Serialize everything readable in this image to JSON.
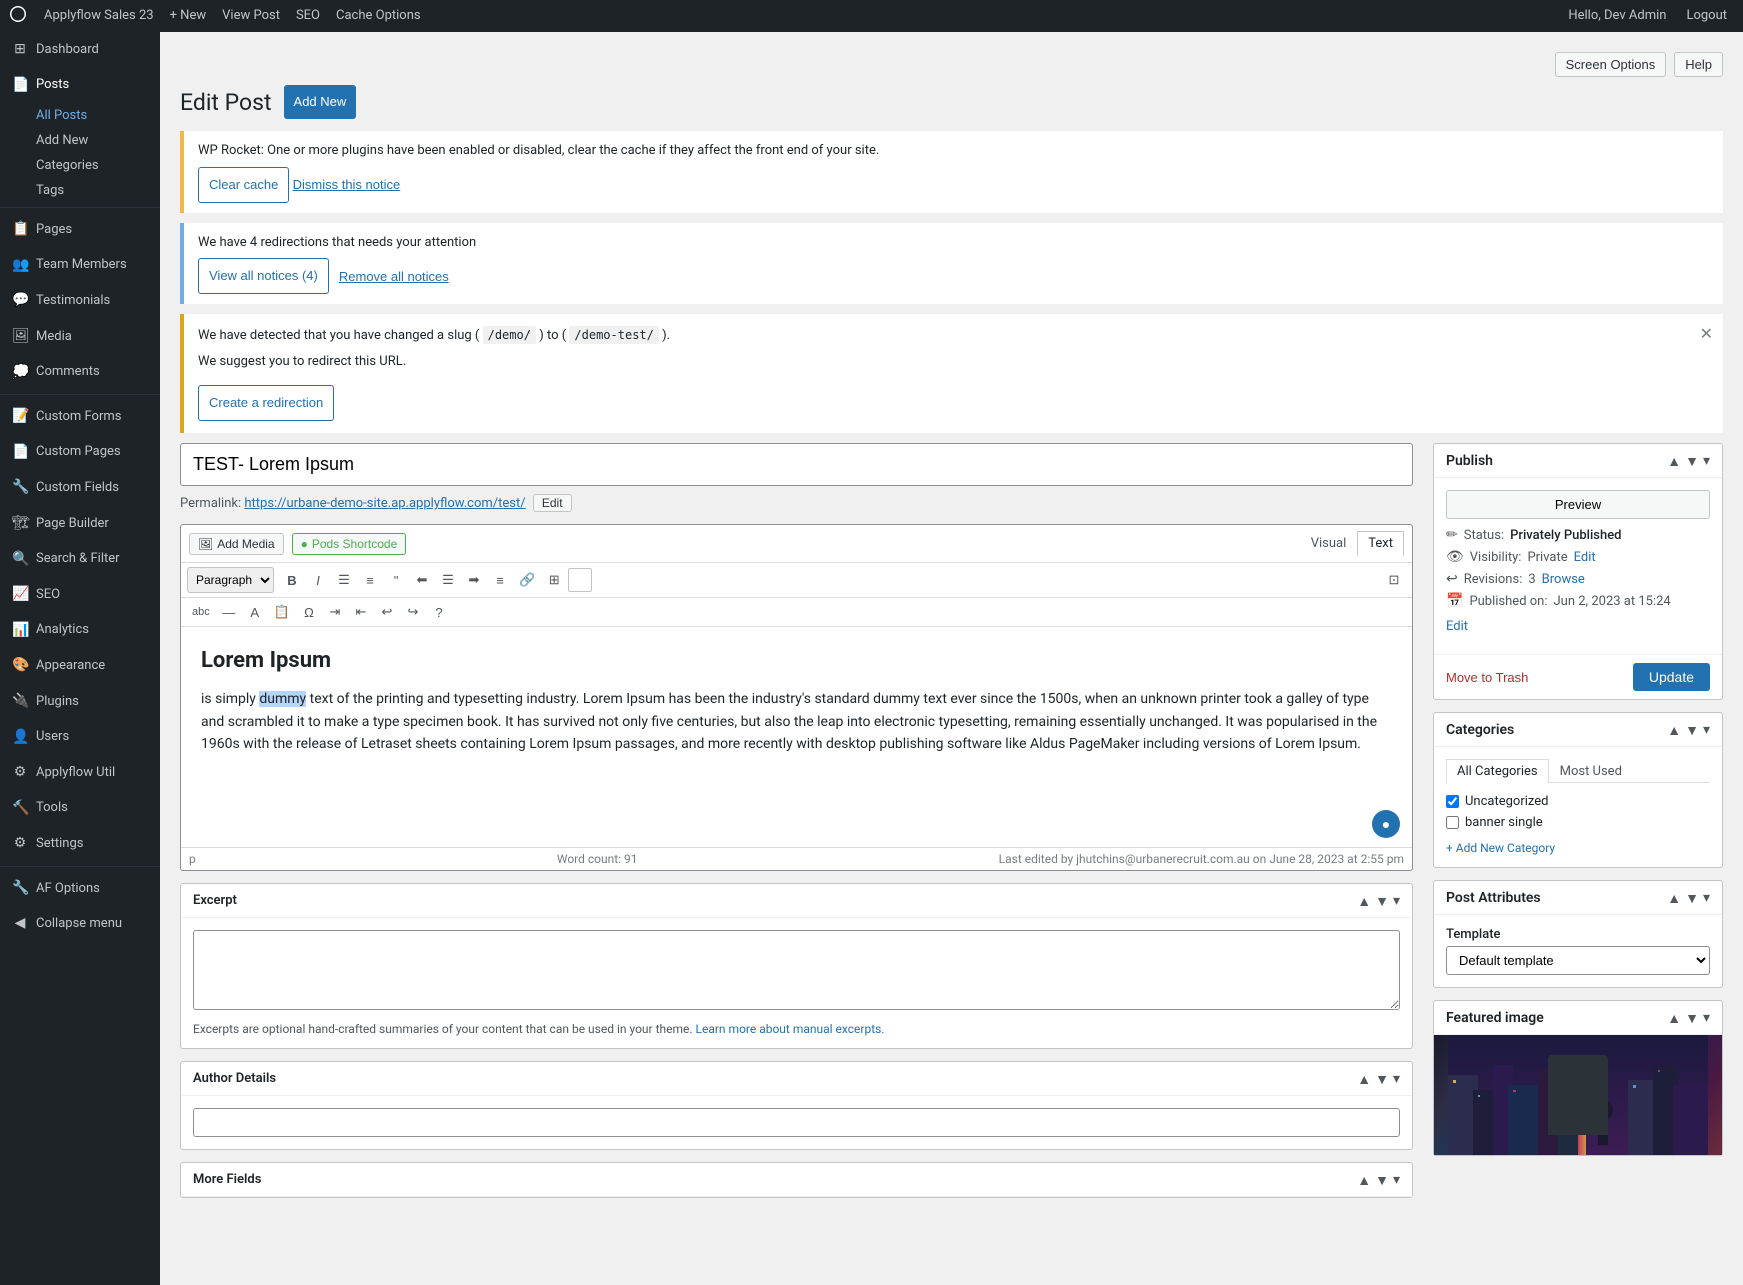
{
  "adminbar": {
    "site_name": "Applyflow Sales 23",
    "new_label": "+ New",
    "view_post": "View Post",
    "seo": "SEO",
    "cache_options": "Cache Options",
    "hello": "Hello, Dev Admin",
    "logout": "Logout"
  },
  "screen_options": {
    "label": "Screen Options",
    "help": "Help"
  },
  "sidebar": {
    "items": [
      {
        "id": "dashboard",
        "label": "Dashboard",
        "icon": "⊞"
      },
      {
        "id": "posts",
        "label": "Posts",
        "icon": "📄"
      },
      {
        "id": "all-posts",
        "label": "All Posts"
      },
      {
        "id": "add-new",
        "label": "Add New"
      },
      {
        "id": "categories",
        "label": "Categories"
      },
      {
        "id": "tags",
        "label": "Tags"
      },
      {
        "id": "pages",
        "label": "Pages",
        "icon": "📋"
      },
      {
        "id": "team-members",
        "label": "Team Members",
        "icon": "👥"
      },
      {
        "id": "testimonials",
        "label": "Testimonials",
        "icon": "💬"
      },
      {
        "id": "media",
        "label": "Media",
        "icon": "🖼"
      },
      {
        "id": "comments",
        "label": "Comments",
        "icon": "💭"
      },
      {
        "id": "custom-forms",
        "label": "Custom Forms",
        "icon": "📝"
      },
      {
        "id": "custom-pages",
        "label": "Custom Pages",
        "icon": "📄"
      },
      {
        "id": "custom-fields",
        "label": "Custom Fields",
        "icon": "🔧"
      },
      {
        "id": "page-builder",
        "label": "Page Builder",
        "icon": "🏗"
      },
      {
        "id": "search-filter",
        "label": "Search & Filter",
        "icon": "🔍"
      },
      {
        "id": "seo",
        "label": "SEO",
        "icon": "📈"
      },
      {
        "id": "analytics",
        "label": "Analytics",
        "icon": "📊"
      },
      {
        "id": "appearance",
        "label": "Appearance",
        "icon": "🎨"
      },
      {
        "id": "plugins",
        "label": "Plugins",
        "icon": "🔌"
      },
      {
        "id": "users",
        "label": "Users",
        "icon": "👤"
      },
      {
        "id": "applyflow-util",
        "label": "Applyflow Util",
        "icon": "⚙"
      },
      {
        "id": "tools",
        "label": "Tools",
        "icon": "🔨"
      },
      {
        "id": "settings",
        "label": "Settings",
        "icon": "⚙"
      },
      {
        "id": "af-options",
        "label": "AF Options",
        "icon": "🔧"
      },
      {
        "id": "collapse",
        "label": "Collapse menu",
        "icon": "◀"
      }
    ]
  },
  "page": {
    "title": "Edit Post",
    "add_new": "Add New"
  },
  "notices": {
    "wp_rocket": {
      "text": "WP Rocket: One or more plugins have been enabled or disabled, clear the cache if they affect the front end of your site.",
      "clear_cache": "Clear cache",
      "dismiss": "Dismiss this notice"
    },
    "redirections": {
      "text": "We have 4 redirections that needs your attention",
      "view_all": "View all notices (4)",
      "remove_all": "Remove all notices"
    },
    "slug": {
      "text1": "We have detected that you have changed a slug (",
      "from_slug": "/demo/",
      "text2": ") to (",
      "to_slug": "/demo-test/",
      "text3": ").",
      "suggestion": "We suggest you to redirect this URL.",
      "create_btn": "Create a redirection"
    }
  },
  "post": {
    "title": "TEST- Lorem Ipsum",
    "permalink_label": "Permalink:",
    "permalink_url": "https://urbane-demo-site.ap.applyflow.com/test/",
    "edit_slug": "Edit",
    "add_media": "Add Media",
    "pods_shortcode": "Pods Shortcode",
    "visual_tab": "Visual",
    "text_tab": "Text",
    "paragraph_selector": "Paragraph",
    "editor_content": {
      "heading": "Lorem Ipsum",
      "body": "is simply dummy text of the printing and typesetting industry. Lorem Ipsum has been the industry's standard dummy text ever since the 1500s, when an unknown printer took a galley of type and scrambled it to make a type specimen book. It has survived not only five centuries, but also the leap into electronic typesetting, remaining essentially unchanged. It was popularised in the 1960s with the release of Letraset sheets containing Lorem Ipsum passages, and more recently with desktop publishing software like Aldus PageMaker including versions of Lorem Ipsum.",
      "highlighted_word": "dummy"
    },
    "editor_footer": {
      "path": "p",
      "word_count": "Word count: 91",
      "last_edited": "Last edited by jhutchins@urbanerecruit.com.au on June 28, 2023 at 2:55 pm"
    }
  },
  "excerpt": {
    "title": "Excerpt",
    "placeholder": "",
    "help_text": "Excerpts are optional hand-crafted summaries of your content that can be used in your theme.",
    "learn_more": "Learn more about manual excerpts."
  },
  "author_details": {
    "title": "Author Details"
  },
  "more_fields": {
    "title": "More Fields"
  },
  "publish": {
    "title": "Publish",
    "preview_btn": "Preview",
    "status_label": "Status:",
    "status_value": "Privately Published",
    "visibility_label": "Visibility:",
    "visibility_value": "Private",
    "visibility_edit": "Edit",
    "revisions_label": "Revisions:",
    "revisions_value": "3",
    "revisions_browse": "Browse",
    "published_label": "Published on:",
    "published_value": "Jun 2, 2023 at 15:24",
    "published_edit": "Edit",
    "trash_btn": "Move to Trash",
    "update_btn": "Update"
  },
  "categories": {
    "title": "Categories",
    "all_tab": "All Categories",
    "most_used_tab": "Most Used",
    "items": [
      {
        "label": "Uncategorized",
        "checked": true
      },
      {
        "label": "banner single",
        "checked": false
      }
    ],
    "add_new": "+ Add New Category"
  },
  "post_attributes": {
    "title": "Post Attributes",
    "template_label": "Template",
    "template_options": [
      "Default template"
    ]
  },
  "featured_image": {
    "title": "Featured image"
  }
}
